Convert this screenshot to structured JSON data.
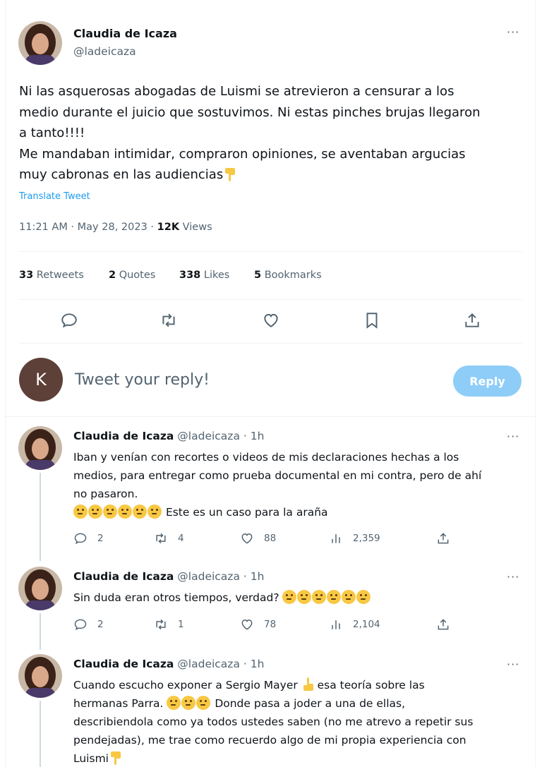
{
  "tweet": {
    "author_name": "Claudia de Icaza",
    "author_handle": "@ladeicaza",
    "text_lines": [
      "Ni las asquerosas abogadas de Luismi se atrevieron a censurar a los",
      "medio durante el juicio que sostuvimos. Ni estas pinches brujas llegaron",
      "a tanto!!!!",
      "Me mandaban intimidar, compraron opiniones, se aventaban argucias",
      "muy cabronas en las audiencias"
    ],
    "translate_label": "Translate Tweet",
    "timestamp": "11:21 AM · May 28, 2023 · ",
    "views_count": "12K",
    "views_label": " Views",
    "more_icon": "more-horizontal-icon"
  },
  "stats": {
    "retweets_count": "33",
    "retweets_label": " Retweets",
    "quotes_count": "2",
    "quotes_label": " Quotes",
    "likes_count": "338",
    "likes_label": " Likes",
    "bookmarks_count": "5",
    "bookmarks_label": " Bookmarks"
  },
  "actions": [
    "reply-icon",
    "retweet-icon",
    "like-icon",
    "bookmark-icon",
    "share-icon"
  ],
  "compose": {
    "avatar_letter": "K",
    "placeholder": "Tweet your reply!",
    "reply_button": "Reply"
  },
  "replies": [
    {
      "name": "Claudia de Icaza",
      "handle_time": "@ladeicaza · 1h",
      "lines": [
        "Iban y venían con recortes o videos de mis declaraciones hechas a los",
        "medios, para entregar como prueba documental en mi contra, pero de ahí",
        "no pasaron."
      ],
      "emoji_line_text": "Este es un caso para la araña",
      "replies": "2",
      "retweets": "4",
      "likes": "88",
      "views": "2,359"
    },
    {
      "name": "Claudia de Icaza",
      "handle_time": "@ladeicaza · 1h",
      "text": "Sin duda eran otros tiempos, verdad?",
      "replies": "2",
      "retweets": "1",
      "likes": "78",
      "views": "2,104"
    },
    {
      "name": "Claudia de Icaza",
      "handle_time": "@ladeicaza · 1h",
      "line1_a": "Cuando escucho exponer a Sergio Mayer",
      "line1_b": "esa teoría sobre las",
      "line2_a": "hermanas Parra.",
      "line2_b": "Donde pasa  a joder a una de ellas,",
      "line3": "describiendola como ya todos ustedes saben (no me atrevo a repetir sus",
      "line4": "pendejadas), me trae como recuerdo algo de mi propia experiencia con",
      "line5": "Luismi"
    }
  ],
  "colors": {
    "accent": "#1d9bf0",
    "reply_button_disabled": "#8ecdf8",
    "text": "#0f1419",
    "muted": "#536471",
    "divider": "#eff3f4"
  }
}
